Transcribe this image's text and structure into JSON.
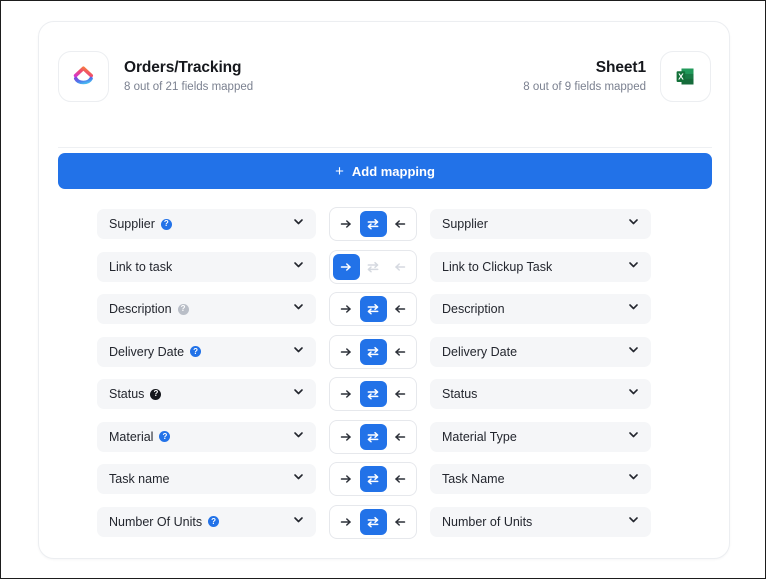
{
  "header": {
    "left": {
      "icon": "clickup-logo-icon",
      "title": "Orders/Tracking",
      "subtitle": "8 out of 21 fields mapped"
    },
    "right": {
      "icon": "excel-logo-icon",
      "title": "Sheet1",
      "subtitle": "8 out of 9 fields mapped"
    }
  },
  "toolbar": {
    "add_mapping_label": "Add mapping",
    "add_mapping_plus": "+",
    "accent_color": "#2272e8"
  },
  "direction_labels": {
    "right": "map left to right",
    "both": "map both ways",
    "left": "map right to left"
  },
  "rows": [
    {
      "left_field": "Supplier",
      "left_badge": "?",
      "left_badge_color": "#2272e8",
      "direction": "both",
      "enabled": true,
      "right_field": "Supplier"
    },
    {
      "left_field": "Link to task",
      "left_badge": "",
      "left_badge_color": "",
      "direction": "right",
      "enabled": false,
      "right_field": "Link to Clickup Task"
    },
    {
      "left_field": "Description",
      "left_badge": "?",
      "left_badge_color": "#b9bec7",
      "direction": "both",
      "enabled": true,
      "right_field": "Description"
    },
    {
      "left_field": "Delivery Date",
      "left_badge": "?",
      "left_badge_color": "#2272e8",
      "direction": "both",
      "enabled": true,
      "right_field": "Delivery Date"
    },
    {
      "left_field": "Status",
      "left_badge": "?",
      "left_badge_color": "#16181d",
      "direction": "both",
      "enabled": true,
      "right_field": "Status"
    },
    {
      "left_field": "Material",
      "left_badge": "?",
      "left_badge_color": "#2272e8",
      "direction": "both",
      "enabled": true,
      "right_field": "Material Type"
    },
    {
      "left_field": "Task name",
      "left_badge": "",
      "left_badge_color": "",
      "direction": "both",
      "enabled": true,
      "right_field": "Task Name"
    },
    {
      "left_field": "Number Of Units",
      "left_badge": "?",
      "left_badge_color": "#2272e8",
      "direction": "both",
      "enabled": true,
      "right_field": "Number of Units"
    }
  ]
}
